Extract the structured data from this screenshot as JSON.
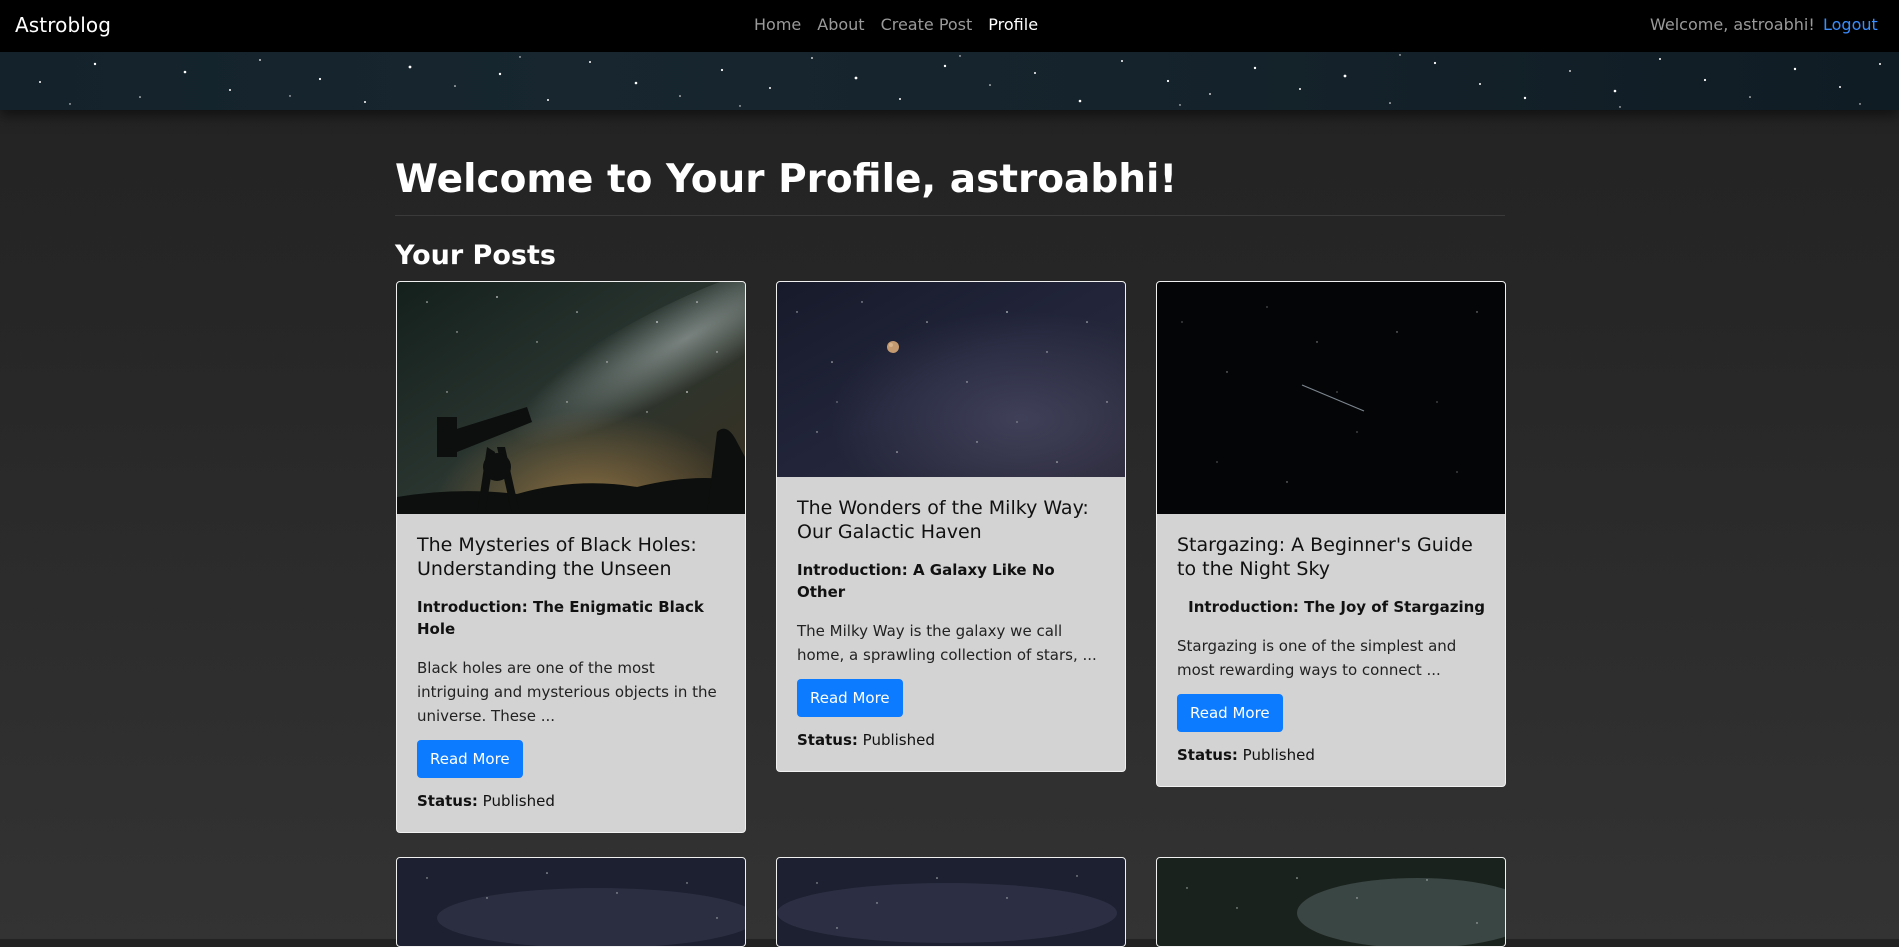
{
  "navbar": {
    "brand": "Astroblog",
    "links": [
      {
        "label": "Home",
        "active": false
      },
      {
        "label": "About",
        "active": false
      },
      {
        "label": "Create Post",
        "active": false
      },
      {
        "label": "Profile",
        "active": true
      }
    ],
    "welcome": "Welcome, astroabhi!",
    "logout": "Logout"
  },
  "main": {
    "title": "Welcome to Your Profile, astroabhi!",
    "section_title": "Your Posts",
    "status_label": "Status:",
    "posts": [
      {
        "title": "The Mysteries of Black Holes: Understanding the Unseen",
        "subtitle": "Introduction: The Enigmatic Black Hole",
        "excerpt": "Black holes are one of the most intriguing and mysterious objects in the universe. These ...",
        "button": "Read More",
        "status": "Published",
        "image": "milky-way-telescope-image"
      },
      {
        "title": "The Wonders of the Milky Way: Our Galactic Haven",
        "subtitle": "Introduction: A Galaxy Like No Other",
        "excerpt": "The Milky Way is the galaxy we call home, a sprawling collection of stars, ...",
        "button": "Read More",
        "status": "Published",
        "image": "night-sky-moon-image"
      },
      {
        "title": "Stargazing: A Beginner's Guide to the Night Sky",
        "subtitle": "Introduction: The Joy of Stargazing",
        "excerpt": "Stargazing is one of the simplest and most rewarding ways to connect ...",
        "button": "Read More",
        "status": "Published",
        "image": "shooting-star-image"
      }
    ]
  },
  "colors": {
    "navbar_bg": "#000000",
    "page_bg": "#262626",
    "card_bg": "#d3d3d3",
    "button_bg": "#0d7bff",
    "logout_link": "#3a8dff"
  }
}
